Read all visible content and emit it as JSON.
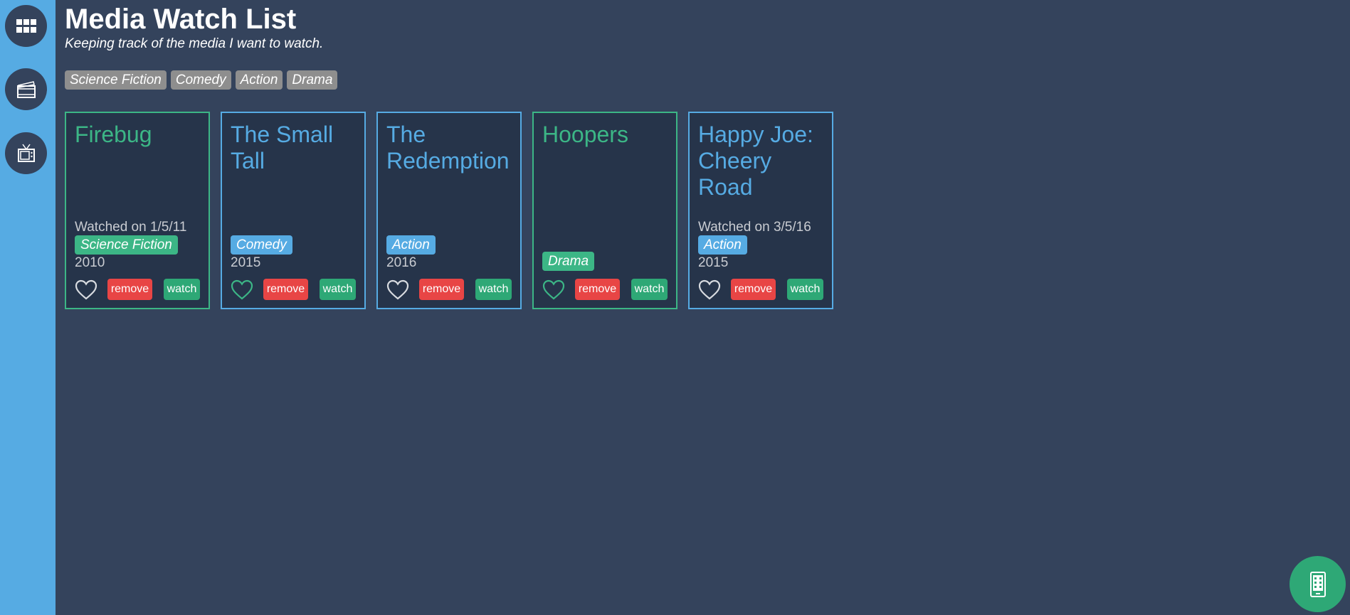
{
  "header": {
    "title": "Media Watch List",
    "subtitle": "Keeping track of the media I want to watch."
  },
  "sidebar": {
    "items": [
      {
        "icon": "grid-icon"
      },
      {
        "icon": "film-icon"
      },
      {
        "icon": "tv-icon"
      }
    ]
  },
  "filters": [
    "Science Fiction",
    "Comedy",
    "Action",
    "Drama"
  ],
  "cards": [
    {
      "title": "Firebug",
      "watched": "Watched on 1/5/11",
      "genre": "Science Fiction",
      "year": "2010",
      "remove": "remove",
      "watch": "watch"
    },
    {
      "title": "The Small Tall",
      "watched": "",
      "genre": "Comedy",
      "year": "2015",
      "remove": "remove",
      "watch": "watch"
    },
    {
      "title": "The Redemption",
      "watched": "",
      "genre": "Action",
      "year": "2016",
      "remove": "remove",
      "watch": "watch"
    },
    {
      "title": "Hoopers",
      "watched": "",
      "genre": "Drama",
      "year": "",
      "remove": "remove",
      "watch": "watch"
    },
    {
      "title": "Happy Joe: Cheery Road",
      "watched": "Watched on 3/5/16",
      "genre": "Action",
      "year": "2015",
      "remove": "remove",
      "watch": "watch"
    }
  ],
  "colors": {
    "background": "#34435c",
    "sidebar": "#56abe3",
    "accent_blue": "#56abe3",
    "accent_green": "#3cb686",
    "remove": "#e84545",
    "watch": "#2ea876"
  },
  "fab": {
    "icon": "mobile-icon"
  }
}
